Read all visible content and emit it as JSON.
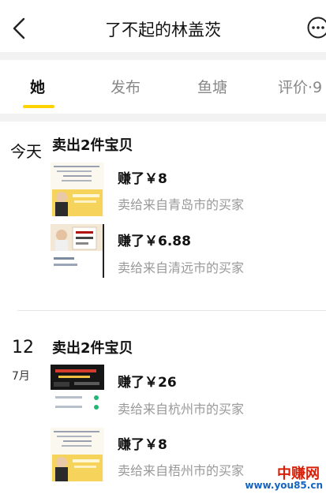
{
  "header": {
    "title": "了不起的林盖茨"
  },
  "tabs": [
    {
      "label": "她"
    },
    {
      "label": "发布"
    },
    {
      "label": "鱼塘"
    },
    {
      "label": "评价·9"
    }
  ],
  "groups": [
    {
      "date_big": "今天",
      "date_small": "",
      "title": "卖出2件宝贝",
      "items": [
        {
          "earn": "赚了￥8",
          "buyer": "卖给来自青岛市的买家",
          "thumb": "yellow-banner-thumbnail"
        },
        {
          "earn": "赚了￥6.88",
          "buyer": "卖给来自清远市的买家",
          "thumb": "person-book-thumbnail"
        }
      ]
    },
    {
      "date_big": "12",
      "date_small": "7月",
      "title": "卖出2件宝贝",
      "items": [
        {
          "earn": "赚了￥26",
          "buyer": "卖给来自杭州市的买家",
          "thumb": "dark-video-thumbnail"
        },
        {
          "earn": "赚了￥8",
          "buyer": "卖给来自梧州市的买家",
          "thumb": "yellow-banner-thumbnail"
        }
      ]
    }
  ],
  "watermark": {
    "top": "中赚网",
    "bottom": "www.you85.cn"
  },
  "colors": {
    "accent": "#ffd200",
    "muted_text": "#999999",
    "band": "#f2f2f2"
  }
}
